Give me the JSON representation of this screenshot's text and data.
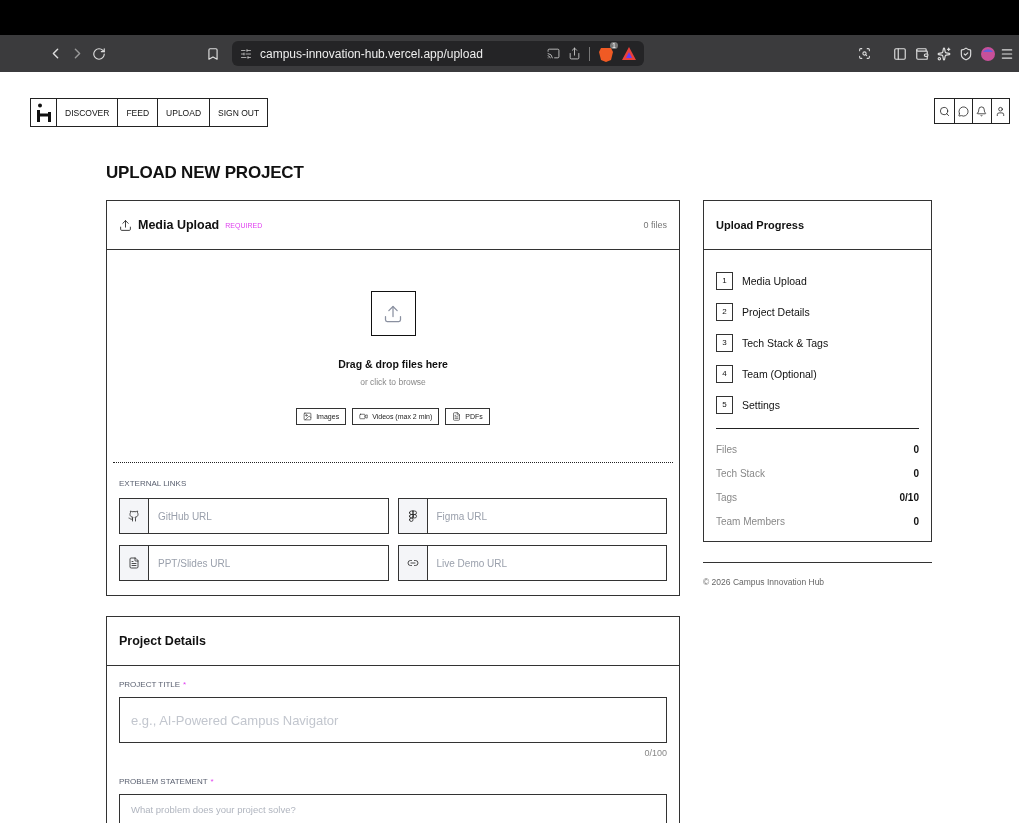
{
  "browser": {
    "url": "campus-innovation-hub.vercel.app/upload",
    "extension_badge": "1"
  },
  "nav": {
    "items": [
      {
        "label": "DISCOVER"
      },
      {
        "label": "FEED"
      },
      {
        "label": "UPLOAD"
      },
      {
        "label": "SIGN OUT"
      }
    ],
    "actions": [
      {
        "kind": "search"
      },
      {
        "kind": "chat"
      },
      {
        "kind": "bell"
      },
      {
        "kind": "user"
      }
    ]
  },
  "page_title": "UPLOAD NEW PROJECT",
  "media_upload": {
    "title": "Media Upload",
    "badge": "REQUIRED",
    "count": "0 files",
    "drop_title": "Drag & drop files here",
    "drop_hint": "or click to browse",
    "file_types": [
      {
        "kind": "image",
        "label": "Images"
      },
      {
        "kind": "video",
        "label": "Videos (max 2 min)"
      },
      {
        "kind": "pdf",
        "label": "PDFs"
      }
    ],
    "external_links": {
      "label": "EXTERNAL LINKS",
      "fields": [
        {
          "kind": "github",
          "placeholder": "GitHub URL"
        },
        {
          "kind": "figma",
          "placeholder": "Figma URL"
        },
        {
          "kind": "slides",
          "placeholder": "PPT/Slides URL"
        },
        {
          "kind": "demo",
          "placeholder": "Live Demo URL"
        }
      ]
    }
  },
  "progress": {
    "title": "Upload Progress",
    "steps": [
      {
        "number": "1",
        "label": "Media Upload"
      },
      {
        "number": "2",
        "label": "Project Details"
      },
      {
        "number": "3",
        "label": "Tech Stack & Tags"
      },
      {
        "number": "4",
        "label": "Team (Optional)"
      },
      {
        "number": "5",
        "label": "Settings"
      }
    ],
    "stats": [
      {
        "label": "Files",
        "value": "0"
      },
      {
        "label": "Tech Stack",
        "value": "0"
      },
      {
        "label": "Tags",
        "value": "0/10"
      },
      {
        "label": "Team Members",
        "value": "0"
      }
    ]
  },
  "footer": "© 2026 Campus Innovation Hub",
  "project_details": {
    "title": "Project Details",
    "fields": [
      {
        "kind": "input",
        "label": "PROJECT TITLE",
        "mark": "*",
        "placeholder": "e.g., AI-Powered Campus Navigator",
        "counter": "0/100"
      },
      {
        "kind": "textarea",
        "label": "PROBLEM STATEMENT",
        "mark": "*",
        "placeholder": "What problem does your project solve?"
      }
    ]
  }
}
